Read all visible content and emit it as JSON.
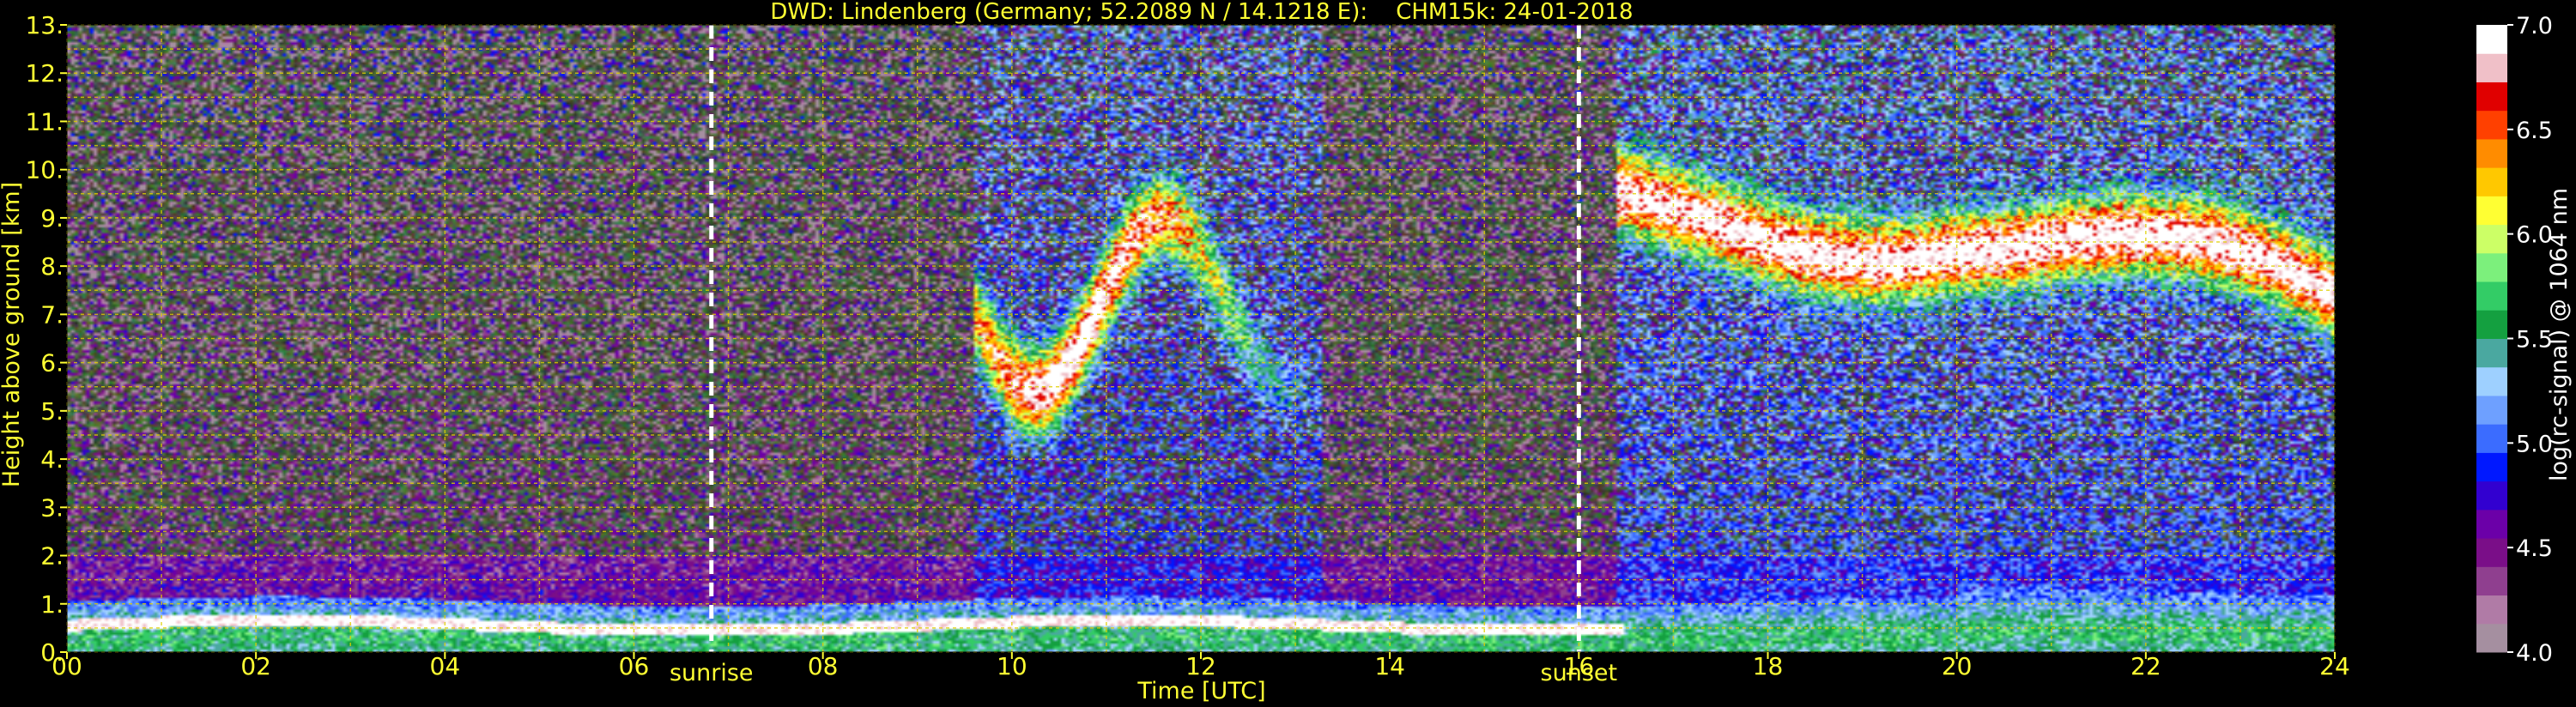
{
  "chart_data": {
    "type": "heatmap",
    "title": "DWD: Lindenberg (Germany; 52.2089 N / 14.1218 E):    CHM15k: 24-01-2018",
    "xlabel": "Time [UTC]",
    "ylabel": "Height above ground [km]",
    "colorbar_label": "log(rc-signal) @ 1064 nm",
    "xlim": [
      0,
      24
    ],
    "ylim": [
      0,
      13
    ],
    "x_ticks": [
      0,
      2,
      4,
      6,
      8,
      10,
      12,
      14,
      16,
      18,
      20,
      22,
      24
    ],
    "x_tick_labels": [
      "00",
      "02",
      "04",
      "06",
      "08",
      "10",
      "12",
      "14",
      "16",
      "18",
      "20",
      "22",
      "24"
    ],
    "y_ticks": [
      0,
      1,
      2,
      3,
      4,
      5,
      6,
      7,
      8,
      9,
      10,
      11,
      12,
      13
    ],
    "y_tick_labels": [
      "0.",
      "1.",
      "2.",
      "3.",
      "4.",
      "5.",
      "6.",
      "7.",
      "8.",
      "9.",
      "10.",
      "11.",
      "12.",
      "13."
    ],
    "grid": true,
    "colorbar_range": [
      4.0,
      7.0
    ],
    "colorbar_ticks": [
      4.0,
      4.5,
      5.0,
      5.5,
      6.0,
      6.5,
      7.0
    ],
    "colorbar_tick_labels": [
      "4.0",
      "4.5",
      "5.0",
      "5.5",
      "6.0",
      "6.5",
      "7.0"
    ],
    "colormap": [
      "#a58fa0",
      "#b07ba6",
      "#8f3f8f",
      "#7a0e88",
      "#6b00a8",
      "#3200d0",
      "#0018ff",
      "#3b6cff",
      "#6ea0ff",
      "#9ed0ff",
      "#4aa8a0",
      "#14a040",
      "#33cc66",
      "#7cf07c",
      "#ccff66",
      "#ffff33",
      "#ffc800",
      "#ff8c00",
      "#ff4000",
      "#e00000",
      "#f0c0c8",
      "#ffffff"
    ],
    "markers": [
      {
        "x": 6.82,
        "label": "sunrise"
      },
      {
        "x": 16.0,
        "label": "sunset"
      }
    ],
    "features": [
      {
        "name": "boundary-layer",
        "x": [
          0,
          24
        ],
        "y": [
          0,
          1.0
        ]
      },
      {
        "name": "cirrus-morning",
        "x": [
          9.5,
          13.5
        ],
        "y": [
          6.0,
          10.0
        ]
      },
      {
        "name": "cirrus-evening",
        "x": [
          16.3,
          24
        ],
        "y": [
          3.5,
          11.8
        ]
      }
    ]
  }
}
